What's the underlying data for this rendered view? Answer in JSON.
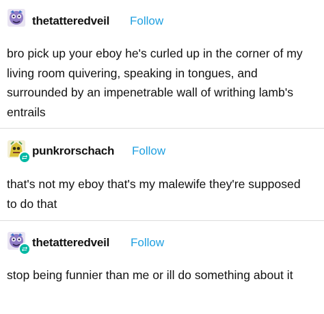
{
  "posts": [
    {
      "username": "thetatteredveil",
      "follow_label": "Follow",
      "avatar": "avatar-purple-creature",
      "body": "bro pick up your eboy he's curled up in the corner of my living room quivering, speaking in tongues, and surrounded by an impenetrable wall of writhing lamb's entrails"
    },
    {
      "username": "punkrorschach",
      "follow_label": "Follow",
      "avatar": "avatar-yellow-creature",
      "reblog_icon": "reblog-icon",
      "body": "that's not my eboy that's my malewife they're supposed to do that"
    },
    {
      "username": "thetatteredveil",
      "follow_label": "Follow",
      "avatar": "avatar-purple-creature",
      "reblog_icon": "reblog-icon",
      "body": "stop being funnier than me or ill do something about it"
    }
  ],
  "colors": {
    "follow": "#1e9fe0",
    "reblog_badge": "#00b8a3",
    "divider": "#dcdcdc"
  }
}
